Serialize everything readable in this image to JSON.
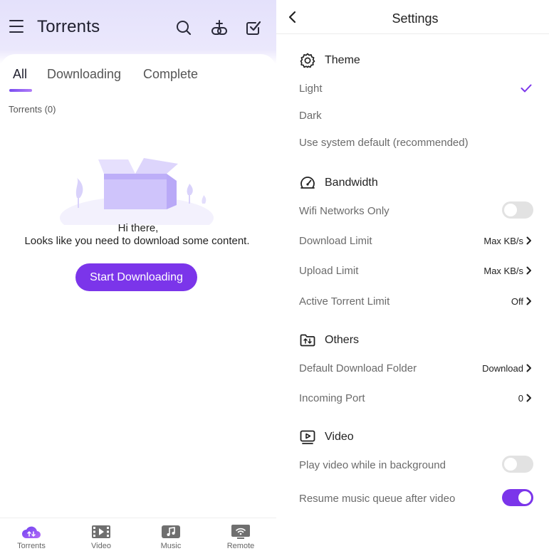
{
  "torrents": {
    "title": "Torrents",
    "tabs": [
      "All",
      "Downloading",
      "Complete"
    ],
    "active_tab": "All",
    "count_label": "Torrents (0)",
    "empty_line1": "Hi there,",
    "empty_line2": "Looks like you need to download some content.",
    "start_button": "Start Downloading",
    "header_icons": [
      "search-icon",
      "add-link-icon",
      "select-icon"
    ]
  },
  "bottom_nav": [
    {
      "label": "Torrents",
      "icon": "torrents-cloud-icon",
      "active": true
    },
    {
      "label": "Video",
      "icon": "video-film-icon",
      "active": false
    },
    {
      "label": "Music",
      "icon": "music-icon",
      "active": false
    },
    {
      "label": "Remote",
      "icon": "remote-icon",
      "active": false
    }
  ],
  "settings": {
    "title": "Settings",
    "theme": {
      "title": "Theme",
      "options": [
        "Light",
        "Dark",
        "Use system default (recommended)"
      ],
      "selected": "Light"
    },
    "bandwidth": {
      "title": "Bandwidth",
      "wifi_only": {
        "label": "Wifi Networks Only",
        "on": false
      },
      "download_limit": {
        "label": "Download Limit",
        "value": "Max KB/s"
      },
      "upload_limit": {
        "label": "Upload Limit",
        "value": "Max KB/s"
      },
      "active_limit": {
        "label": "Active Torrent Limit",
        "value": "Off"
      }
    },
    "others": {
      "title": "Others",
      "download_folder": {
        "label": "Default Download Folder",
        "value": "Download"
      },
      "incoming_port": {
        "label": "Incoming Port",
        "value": "0"
      }
    },
    "video": {
      "title": "Video",
      "play_background": {
        "label": "Play video while in background",
        "on": false
      },
      "resume_music": {
        "label": "Resume music queue after video",
        "on": true
      }
    }
  },
  "colors": {
    "accent": "#7b35ea",
    "header_bg": "#e4e1fb",
    "toggle_off": "#e2e2e2",
    "label_gray": "#6b6b6b"
  }
}
